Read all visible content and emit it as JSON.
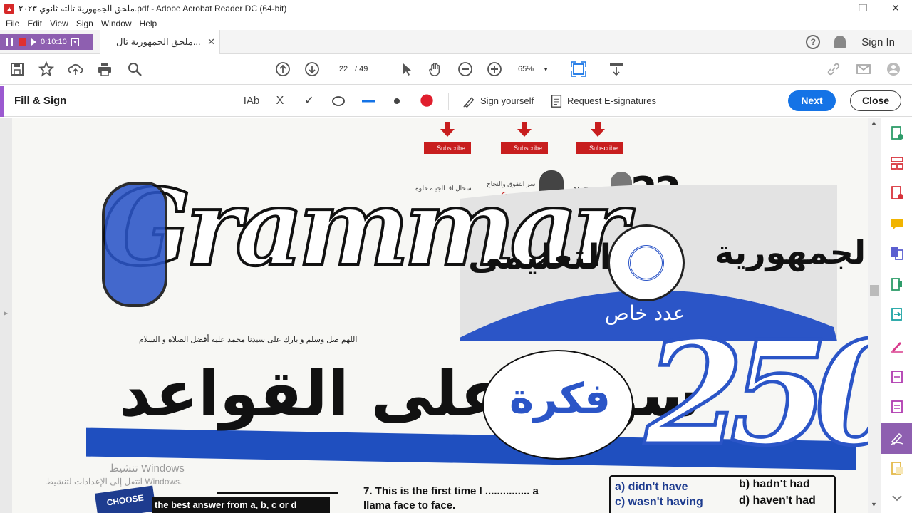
{
  "window": {
    "title": "ملحق الجمهورية تالته ثانوي ٢٠٢٣.pdf - Adobe Acrobat Reader DC (64-bit)",
    "minimize": "—",
    "restore": "❐",
    "close": "✕"
  },
  "menu": [
    "File",
    "Edit",
    "View",
    "Sign",
    "Window",
    "Help"
  ],
  "recorder": {
    "time": "0:10:10"
  },
  "tab": {
    "label": "ملحق الجمهورية تال...",
    "close": "✕"
  },
  "header": {
    "help": "?",
    "signin": "Sign In"
  },
  "toolbar": {
    "page_current": "22",
    "page_total": "/ 49",
    "zoom": "65%"
  },
  "fill_sign": {
    "title": "Fill & Sign",
    "text_tool": "IAb",
    "cross": "X",
    "check": "✓",
    "sign_yourself": "Sign yourself",
    "request": "Request E-signatures",
    "next": "Next",
    "close": "Close"
  },
  "document": {
    "subscribe": "Subscribe",
    "page_number": "22",
    "author": "Ali Goodah",
    "tagline_left": "سحال اقـ الجيـة حلوة",
    "tagline_mid": "سر التفوق والنجاح",
    "title_en": "Grammar",
    "ar_gomhoreya": "الجمهورية",
    "ar_taalimi": "التعليمى",
    "ar_special": "عدد خاص",
    "prayer": "اللهم صل وسلم و بارك على سيدنا محمد عليه أفضل الصلاة و السلام",
    "ar_questions": "سؤال على القواعد",
    "ar_fekra": "فكرة",
    "count": "250",
    "choose": "CHOOSE",
    "choose_text": "the best answer from a, b, c or d",
    "q7_line1": "7. This is the first time I ............... a",
    "q7_line2": "llama face to face.",
    "opt_a": "a) didn't have",
    "opt_b": "b) hadn't had",
    "opt_c": "c) wasn't having",
    "opt_d": "d) haven't had"
  },
  "watermark": {
    "line1": "تنشيط Windows",
    "line2": "انتقل إلى الإعدادات لتنشيط Windows."
  }
}
